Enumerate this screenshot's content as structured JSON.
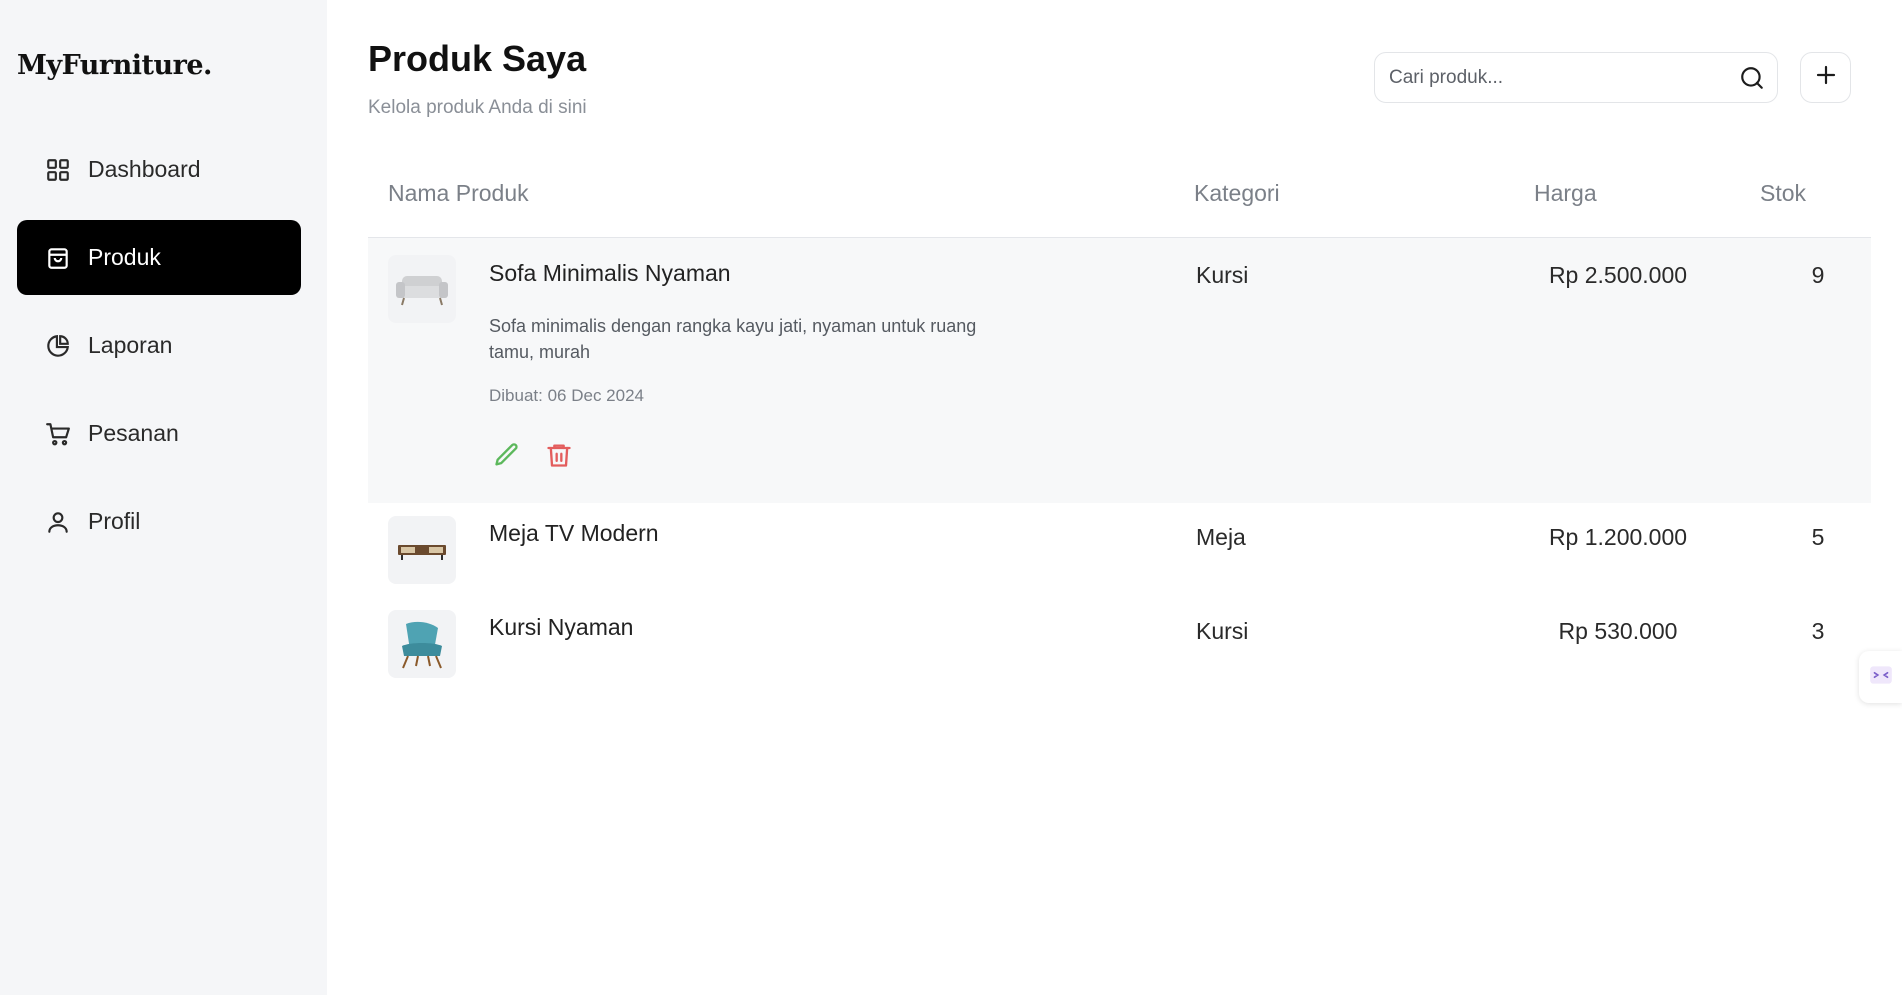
{
  "app": {
    "logo": "MyFurniture."
  },
  "sidebar": {
    "items": [
      {
        "label": "Dashboard",
        "icon": "grid-icon",
        "active": false
      },
      {
        "label": "Produk",
        "icon": "shopping-bag-icon",
        "active": true
      },
      {
        "label": "Laporan",
        "icon": "pie-chart-icon",
        "active": false
      },
      {
        "label": "Pesanan",
        "icon": "cart-icon",
        "active": false
      },
      {
        "label": "Profil",
        "icon": "user-icon",
        "active": false
      }
    ]
  },
  "header": {
    "title": "Produk Saya",
    "subtitle": "Kelola produk Anda di sini",
    "search_placeholder": "Cari produk...",
    "search_icon": "search-icon",
    "add_icon": "plus-icon"
  },
  "table": {
    "columns": [
      "Nama Produk",
      "Kategori",
      "Harga",
      "Stok"
    ],
    "rows": [
      {
        "name": "Sofa Minimalis Nyaman",
        "description": "Sofa minimalis dengan rangka kayu jati, nyaman untuk ruang tamu, murah",
        "created": "Dibuat: 06 Dec 2024",
        "category": "Kursi",
        "price": "Rp 2.500.000",
        "stock": "9",
        "image_icon": "sofa-image",
        "expanded": true
      },
      {
        "name": "Meja TV Modern",
        "category": "Meja",
        "price": "Rp 1.200.000",
        "stock": "5",
        "image_icon": "tv-table-image",
        "expanded": false
      },
      {
        "name": "Kursi Nyaman",
        "category": "Kursi",
        "price": "Rp 530.000",
        "stock": "3",
        "image_icon": "armchair-image",
        "expanded": false
      }
    ]
  },
  "colors": {
    "accent": "#000000",
    "sidebar_bg": "#f5f6f8",
    "edit": "#5cb85c",
    "delete": "#e35d5d"
  }
}
